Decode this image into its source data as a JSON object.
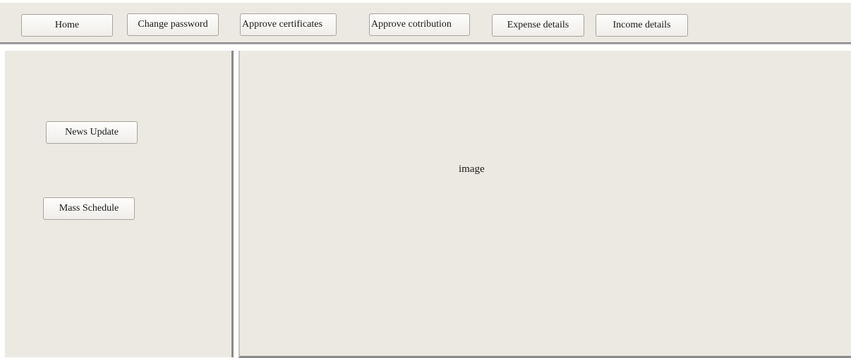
{
  "top_nav": {
    "home": "Home",
    "change_password": "Change password",
    "approve_certificates": "Approve certificates",
    "approve_contribution": "Approve cotribution",
    "expense_details": "Expense details",
    "income_details": "Income details"
  },
  "sidebar": {
    "news_update": "News Update",
    "mass_schedule": "Mass Schedule"
  },
  "main": {
    "image_placeholder": "image"
  },
  "colors": {
    "panel_background": "#ece9e3",
    "panel_border": "#8a8a8a",
    "button_border": "#a9a39c"
  }
}
